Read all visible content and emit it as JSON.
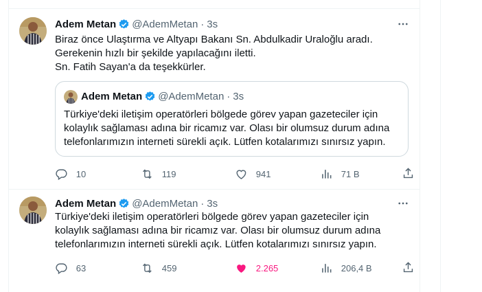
{
  "tweets": [
    {
      "author": {
        "name": "Adem Metan",
        "handle": "@AdemMetan",
        "time": "3s",
        "separator": "·"
      },
      "text_lines": [
        "Biraz önce Ulaştırma ve Altyapı Bakanı Sn. Abdulkadir Uraloğlu aradı.",
        "Gerekenin hızlı bir şekilde yapılacağını iletti.",
        "Sn. Fatih Sayan'a da teşekkürler."
      ],
      "quote": {
        "author": {
          "name": "Adem Metan",
          "handle": "@AdemMetan",
          "time": "3s",
          "separator": "·"
        },
        "text_lines": [
          "Türkiye'deki iletişim operatörleri bölgede görev yapan gazeteciler için",
          "kolaylık sağlaması adına bir ricamız var. Olası bir olumsuz durum adına",
          "telefonlarımızın interneti sürekli açık. Lütfen kotalarımızı sınırsız yapın."
        ]
      },
      "stats": {
        "replies": "10",
        "reposts": "119",
        "likes": "941",
        "views": "71 B"
      }
    },
    {
      "author": {
        "name": "Adem Metan",
        "handle": "@AdemMetan",
        "time": "3s",
        "separator": "·"
      },
      "text_lines": [
        "Türkiye'deki iletişim operatörleri bölgede görev yapan gazeteciler için",
        "kolaylık sağlaması adına bir ricamız var. Olası bir olumsuz durum adına",
        "telefonlarımızın interneti sürekli açık. Lütfen kotalarımızı sınırsız yapın."
      ],
      "stats": {
        "replies": "63",
        "reposts": "459",
        "likes": "2.265",
        "views": "206,4 B"
      }
    }
  ],
  "icons": {
    "verified": "verified-badge-icon",
    "more": "more-icon",
    "reply": "reply-icon",
    "repost": "repost-icon",
    "like": "heart-icon",
    "views": "views-chart-icon",
    "share": "share-icon"
  },
  "colors": {
    "verified": "#1d9bf0",
    "liked": "#f91880",
    "muted": "#536471",
    "border": "#eff3f4"
  }
}
